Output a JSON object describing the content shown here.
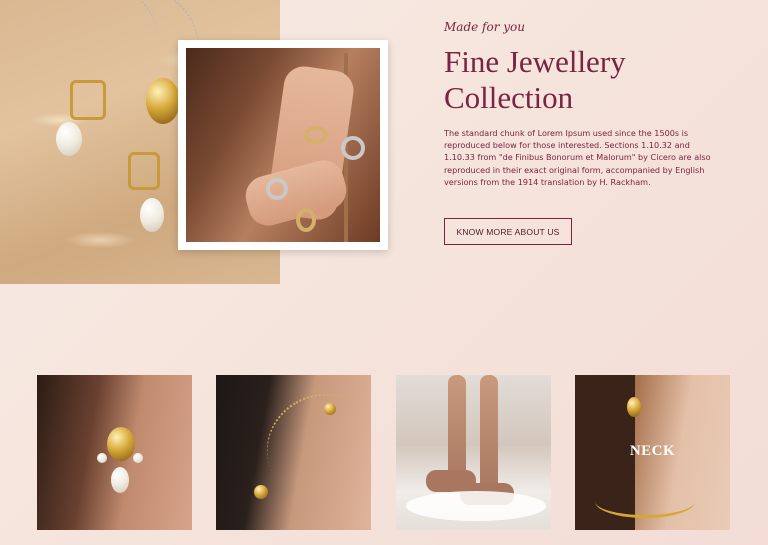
{
  "hero": {
    "tagline": "Made for you",
    "title": "Fine Jewellery Collection",
    "description": "The standard chunk of Lorem Ipsum used since the 1500s is reproduced below for those interested. Sections 1.10.32 and 1.10.33 from \"de Finibus Bonorum et Malorum\" by Cicero are also reproduced in their exact original form, accompanied by English versions from the 1914 translation by H. Rackham.",
    "cta_label": "KNOW MORE ABOUT US"
  },
  "cards": [
    {
      "label": ""
    },
    {
      "label": ""
    },
    {
      "label": ""
    },
    {
      "label": "NECK"
    }
  ],
  "colors": {
    "accent": "#7a2342",
    "background": "#f5e4dc"
  }
}
